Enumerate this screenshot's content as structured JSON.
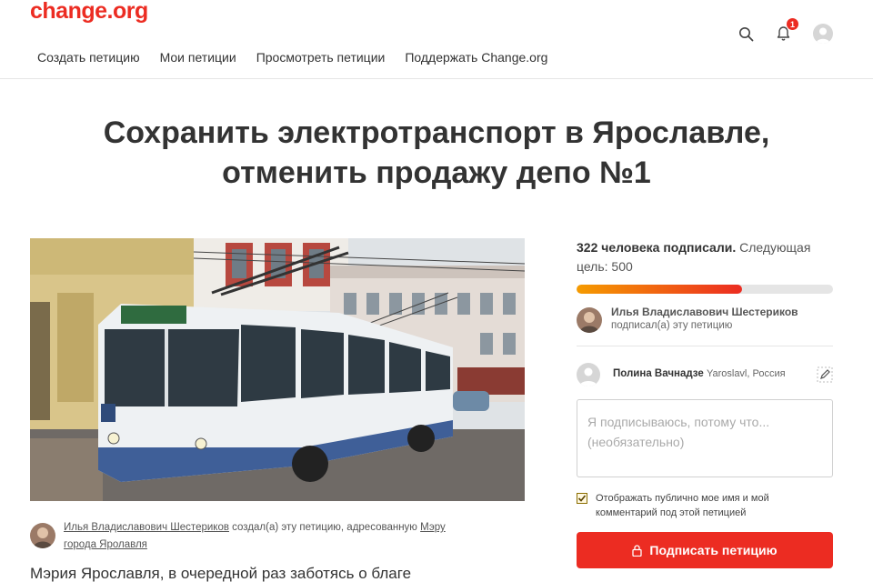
{
  "header": {
    "logo": "change.org",
    "nav": [
      "Создать петицию",
      "Мои петиции",
      "Просмотреть петиции",
      "Поддержать Change.org"
    ],
    "notification_count": "1",
    "icons": [
      "search-icon",
      "bell-icon",
      "user-avatar-icon"
    ]
  },
  "petition": {
    "title_line1": "Сохранить электротранспорт в Ярославле,",
    "title_line2": "отменить продажу депо №1",
    "author_name": "Илья Владиславович Шестериков",
    "author_action": " создал(а) эту петицию, адресованную ",
    "recipient_line1": "Мэру",
    "recipient_line2": "города Яролавля",
    "body_start": "Мэрия Ярославля, в очередной раз заботясь о благе"
  },
  "sidebar": {
    "count_bold": "322 человека подписали.",
    "count_rest": " Следующая цель: 500",
    "progress_fraction": 0.644,
    "recent_signer_name": "Илья Владиславович Шестериков",
    "recent_signer_action": "подписал(а) эту петицию",
    "current_user_name": "Полина Вачнадзе",
    "current_user_location": "Yaroslavl, Россия",
    "reason_placeholder": "Я подписываюсь, потому что... (необязательно)",
    "public_checkbox_checked": true,
    "public_checkbox_label": "Отображать публично мое имя и мой комментарий под этой петицией",
    "sign_button_label": "Подписать петицию"
  },
  "colors": {
    "brand": "#ec2c22",
    "progress_start": "#f59b00"
  }
}
